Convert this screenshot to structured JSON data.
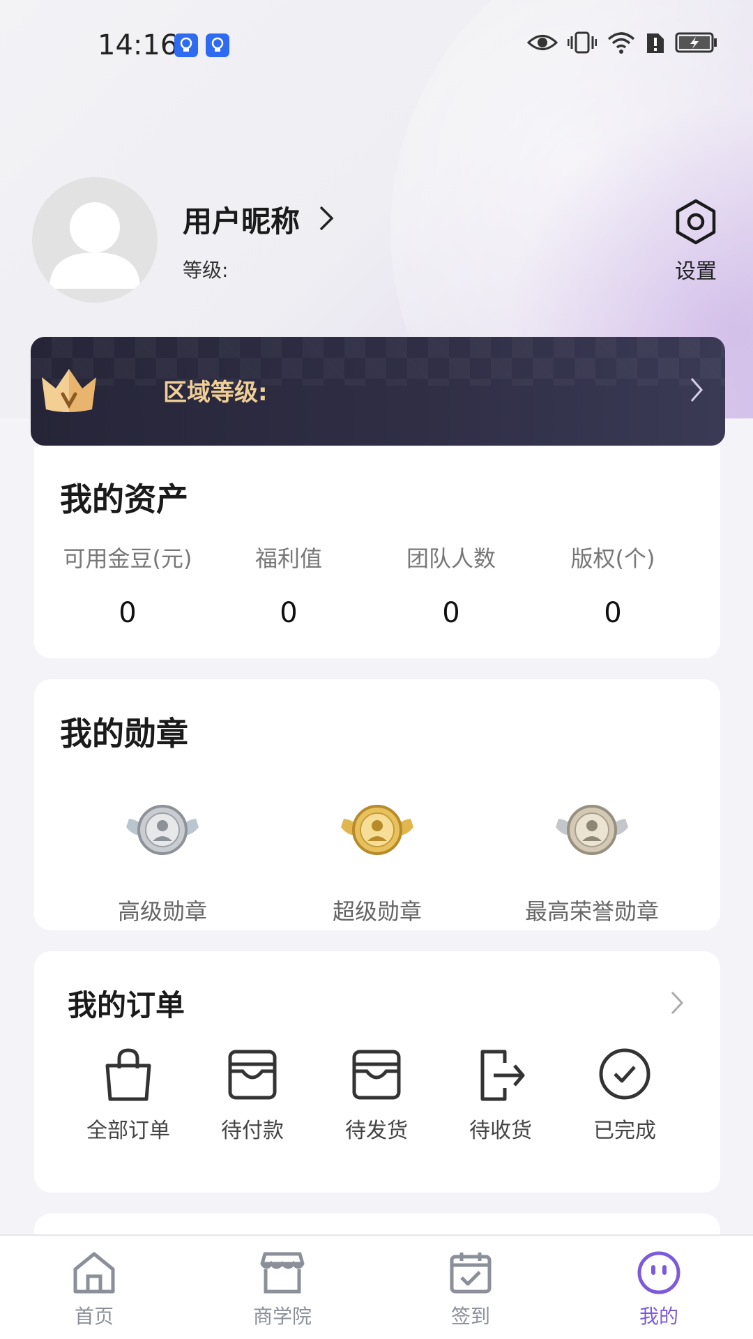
{
  "status_bar": {
    "time": "14:16"
  },
  "profile": {
    "nickname": "用户昵称",
    "level_label": "等级:",
    "settings_label": "设置"
  },
  "region": {
    "label": "区域等级:"
  },
  "assets": {
    "title": "我的资产",
    "items": [
      {
        "label": "可用金豆(元)",
        "value": "0"
      },
      {
        "label": "福利值",
        "value": "0"
      },
      {
        "label": "团队人数",
        "value": "0"
      },
      {
        "label": "版权(个)",
        "value": "0"
      }
    ]
  },
  "medals": {
    "title": "我的勋章",
    "items": [
      {
        "label": "高级勋章",
        "tone": "silver"
      },
      {
        "label": "超级勋章",
        "tone": "gold"
      },
      {
        "label": "最高荣誉勋章",
        "tone": "silver"
      }
    ]
  },
  "orders": {
    "title": "我的订单",
    "items": [
      {
        "label": "全部订单",
        "icon": "shopping-bag-icon"
      },
      {
        "label": "待付款",
        "icon": "wallet-icon"
      },
      {
        "label": "待发货",
        "icon": "wallet-icon"
      },
      {
        "label": "待收货",
        "icon": "exit-arrow-icon"
      },
      {
        "label": "已完成",
        "icon": "check-circle-icon"
      }
    ]
  },
  "bottom_nav": {
    "items": [
      {
        "label": "首页",
        "icon": "home-icon"
      },
      {
        "label": "商学院",
        "icon": "store-icon"
      },
      {
        "label": "签到",
        "icon": "calendar-check-icon"
      },
      {
        "label": "我的",
        "icon": "profile-face-icon",
        "active": true
      }
    ]
  },
  "colors": {
    "accent": "#7d5ad9",
    "banner_gold": "#f0cf96",
    "banner_dark": "#2a293d",
    "status_badge": "#2f6bf0"
  }
}
